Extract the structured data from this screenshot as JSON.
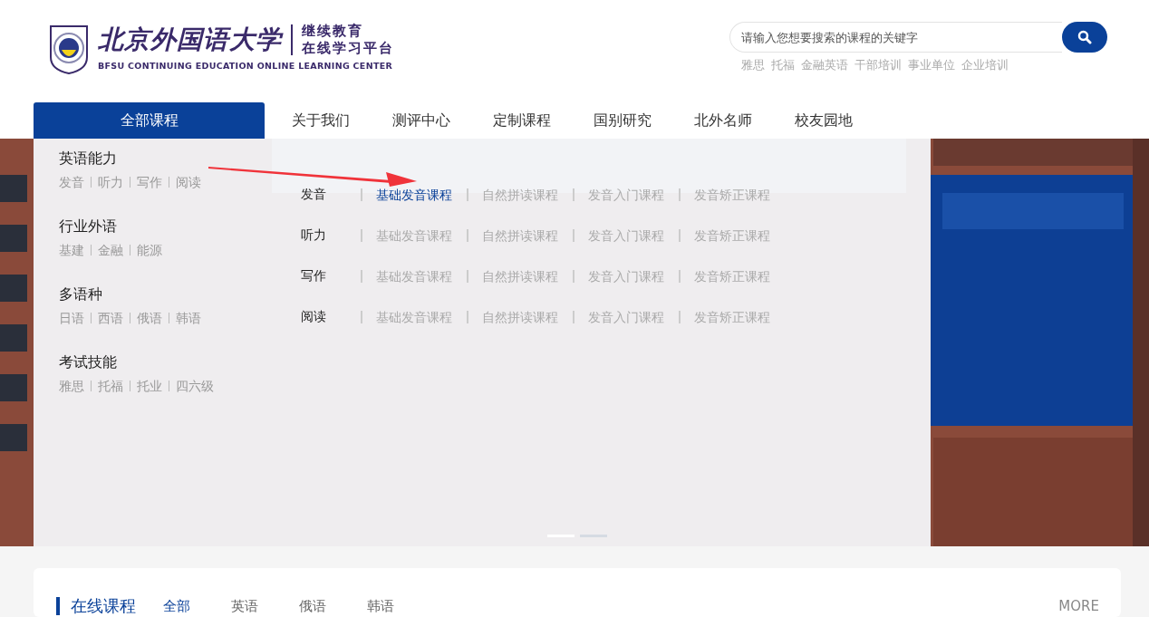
{
  "header": {
    "logo": {
      "name": "北京外国语大学",
      "subtitle_lines": [
        "继续教育",
        "在线学习平台"
      ],
      "english": "BFSU CONTINUING EDUCATION ONLINE LEARNING CENTER"
    },
    "search": {
      "placeholder": "请输入您想要搜索的课程的关键字"
    },
    "hot_words": [
      "雅思",
      "托福",
      "金融英语",
      "干部培训",
      "事业单位",
      "企业培训"
    ]
  },
  "nav": [
    {
      "label": "全部课程",
      "selected": true
    },
    {
      "label": "关于我们",
      "selected": false
    },
    {
      "label": "测评中心",
      "selected": false
    },
    {
      "label": "定制课程",
      "selected": false
    },
    {
      "label": "国别研究",
      "selected": false
    },
    {
      "label": "北外名师",
      "selected": false
    },
    {
      "label": "校友园地",
      "selected": false
    }
  ],
  "menu": {
    "categories": [
      {
        "title": "英语能力",
        "items": [
          "发音",
          "听力",
          "写作",
          "阅读"
        ]
      },
      {
        "title": "行业外语",
        "items": [
          "基建",
          "金融",
          "能源"
        ]
      },
      {
        "title": "多语种",
        "items": [
          "日语",
          "西语",
          "俄语",
          "韩语"
        ]
      },
      {
        "title": "考试技能",
        "items": [
          "雅思",
          "托福",
          "托业",
          "四六级"
        ]
      }
    ],
    "rows": [
      {
        "label": "发音",
        "links": [
          {
            "label": "基础发音课程",
            "selected": true
          },
          {
            "label": "自然拼读课程",
            "selected": false
          },
          {
            "label": "发音入门课程",
            "selected": false
          },
          {
            "label": "发音矫正课程",
            "selected": false
          }
        ]
      },
      {
        "label": "听力",
        "links": [
          {
            "label": "基础发音课程",
            "selected": false
          },
          {
            "label": "自然拼读课程",
            "selected": false
          },
          {
            "label": "发音入门课程",
            "selected": false
          },
          {
            "label": "发音矫正课程",
            "selected": false
          }
        ]
      },
      {
        "label": "写作",
        "links": [
          {
            "label": "基础发音课程",
            "selected": false
          },
          {
            "label": "自然拼读课程",
            "selected": false
          },
          {
            "label": "发音入门课程",
            "selected": false
          },
          {
            "label": "发音矫正课程",
            "selected": false
          }
        ]
      },
      {
        "label": "阅读",
        "links": [
          {
            "label": "基础发音课程",
            "selected": false
          },
          {
            "label": "自然拼读课程",
            "selected": false
          },
          {
            "label": "发音入门课程",
            "selected": false
          },
          {
            "label": "发音矫正课程",
            "selected": false
          }
        ]
      }
    ]
  },
  "banner": {
    "kind": "picture",
    "slides": [
      {
        "selected": true
      },
      {
        "selected": false
      }
    ]
  },
  "courses": {
    "title": "在线课程",
    "tabs": [
      {
        "label": "全部",
        "selected": true
      },
      {
        "label": "英语",
        "selected": false
      },
      {
        "label": "俄语",
        "selected": false
      },
      {
        "label": "韩语",
        "selected": false
      }
    ],
    "more": "MORE"
  }
}
